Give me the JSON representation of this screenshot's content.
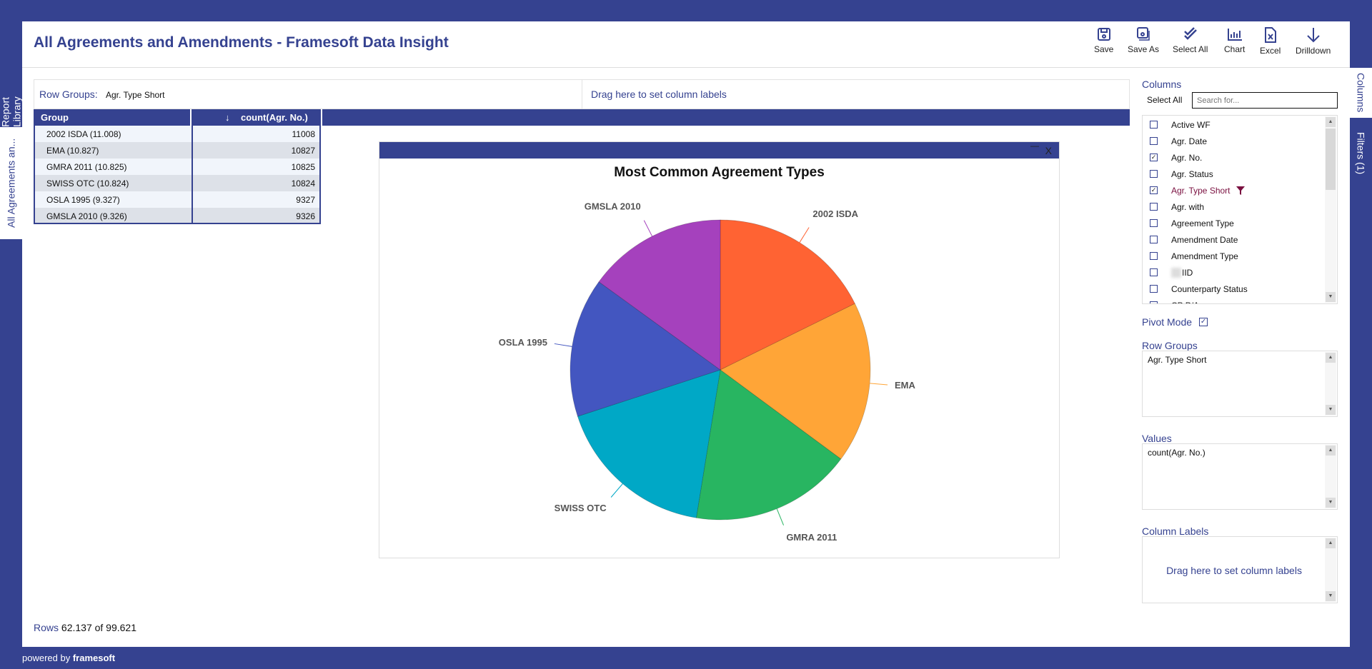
{
  "header": {
    "title": "All Agreements and Amendments - Framesoft Data Insight"
  },
  "toolbar": [
    {
      "label": "Save",
      "icon": "save"
    },
    {
      "label": "Save As",
      "icon": "save-as"
    },
    {
      "label": "Select All",
      "icon": "double-check"
    },
    {
      "label": "Chart",
      "icon": "bar-chart"
    },
    {
      "label": "Excel",
      "icon": "excel"
    },
    {
      "label": "Drilldown",
      "icon": "arrow-down"
    }
  ],
  "left_tabs": [
    "Report Library",
    "All Agreements an..."
  ],
  "right_tabs": [
    "Columns",
    "Filters (1)"
  ],
  "row_groups_bar": {
    "label": "Row Groups:",
    "value": "Agr. Type Short",
    "drag_text": "Drag here to set column labels"
  },
  "grid": {
    "columns": [
      "Group",
      "count(Agr. No.)"
    ],
    "rows": [
      [
        "2002 ISDA (11.008)",
        "11008"
      ],
      [
        "EMA (10.827)",
        "10827"
      ],
      [
        "GMRA 2011 (10.825)",
        "10825"
      ],
      [
        "SWISS OTC (10.824)",
        "10824"
      ],
      [
        "OSLA 1995 (9.327)",
        "9327"
      ],
      [
        "GMSLA 2010 (9.326)",
        "9326"
      ]
    ]
  },
  "chart_data": {
    "type": "pie",
    "title": "Most Common Agreement Types",
    "categories": [
      "2002 ISDA",
      "EMA",
      "GMRA 2011",
      "SWISS OTC",
      "OSLA 1995",
      "GMSLA 2010"
    ],
    "values": [
      11008,
      10827,
      10825,
      10824,
      9327,
      9326
    ],
    "colors": [
      "#ff6333",
      "#ffa537",
      "#28b561",
      "#00a8c6",
      "#4356c0",
      "#a541bd"
    ]
  },
  "chart_window": {
    "minimize": "—",
    "close": "X"
  },
  "side_panel": {
    "columns_label": "Columns",
    "select_all": "Select All",
    "search_placeholder": "Search for...",
    "columns": [
      {
        "name": "Active WF",
        "checked": false
      },
      {
        "name": "Agr. Date",
        "checked": false
      },
      {
        "name": "Agr. No.",
        "checked": true
      },
      {
        "name": "Agr. Status",
        "checked": false
      },
      {
        "name": "Agr. Type Short",
        "checked": true,
        "filtered": true
      },
      {
        "name": "Agr. with",
        "checked": false
      },
      {
        "name": "Agreement Type",
        "checked": false
      },
      {
        "name": "Amendment Date",
        "checked": false
      },
      {
        "name": "Amendment Type",
        "checked": false
      },
      {
        "name": "IID",
        "checked": false
      },
      {
        "name": "Counterparty Status",
        "checked": false
      },
      {
        "name": "CP P/A",
        "checked": false
      }
    ],
    "pivot_mode": "Pivot Mode",
    "pivot_checked": true,
    "row_groups_label": "Row Groups",
    "row_groups": [
      "Agr. Type Short"
    ],
    "values_label": "Values",
    "values": [
      "count(Agr. No.)"
    ],
    "column_labels_label": "Column Labels",
    "column_labels_drag": "Drag here to set column labels"
  },
  "status": {
    "rows_label": "Rows",
    "rows_value": "62.137 of 99.621"
  },
  "footer": {
    "powered_by": "powered by",
    "brand": "framesoft"
  },
  "colors": {
    "brand": "#354290",
    "filter": "#7a1040"
  }
}
